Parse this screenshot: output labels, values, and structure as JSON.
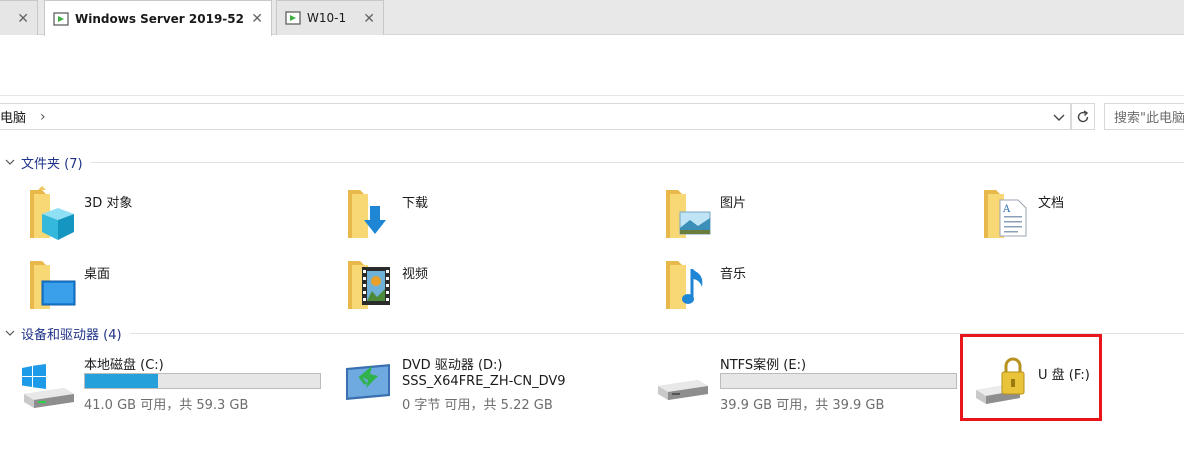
{
  "tabs": [
    {
      "label": "",
      "active": false
    },
    {
      "label": "Windows Server 2019-52",
      "active": true
    },
    {
      "label": "W10-1",
      "active": false
    }
  ],
  "address": {
    "path": "电脑",
    "search_placeholder": "搜索\"此电脑\""
  },
  "folders_section": {
    "title": "文件夹 (7)"
  },
  "folders": [
    {
      "label": "3D 对象",
      "icon": "3d-objects-folder-icon"
    },
    {
      "label": "下载",
      "icon": "downloads-folder-icon"
    },
    {
      "label": "图片",
      "icon": "pictures-folder-icon"
    },
    {
      "label": "文档",
      "icon": "documents-folder-icon"
    },
    {
      "label": "桌面",
      "icon": "desktop-folder-icon"
    },
    {
      "label": "视频",
      "icon": "videos-folder-icon"
    },
    {
      "label": "音乐",
      "icon": "music-folder-icon"
    }
  ],
  "drives_section": {
    "title": "设备和驱动器 (4)"
  },
  "drives": [
    {
      "name": "本地磁盘 (C:)",
      "space": "41.0 GB 可用，共 59.3 GB",
      "used_fraction": 0.31
    },
    {
      "name": "DVD 驱动器 (D:)",
      "sub": "SSS_X64FRE_ZH-CN_DV9",
      "space": "0 字节 可用，共 5.22 GB"
    },
    {
      "name": "NTFS案例 (E:)",
      "space": "39.9 GB 可用，共 39.9 GB",
      "used_fraction": 0.0
    },
    {
      "name": "U 盘 (F:)"
    }
  ],
  "colors": {
    "accent_bar": "#26a0da",
    "section_text": "#1e3287",
    "highlight": "#e8151b"
  }
}
